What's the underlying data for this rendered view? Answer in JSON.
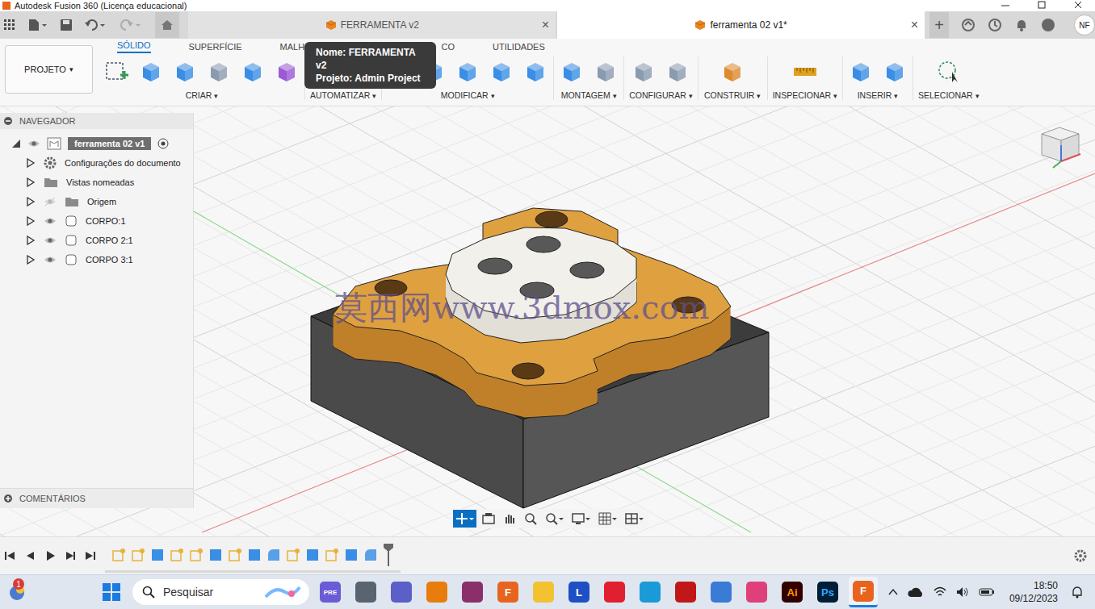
{
  "window": {
    "title": "Autodesk Fusion 360 (Licença educacional)"
  },
  "document_tabs": [
    {
      "label": "FERRAMENTA v2",
      "selected": false,
      "close": "×"
    },
    {
      "label": "ferramenta 02 v1*",
      "selected": true,
      "close": "×"
    }
  ],
  "new_tab": "+",
  "user": {
    "initials": "NF"
  },
  "tooltip": {
    "lines": [
      "Nome: FERRAMENTA v2",
      "Projeto: Admin Project"
    ]
  },
  "workspace_tabs": [
    {
      "label": "SÓLIDO",
      "selected": true
    },
    {
      "label": "SUPERFÍCIE",
      "selected": false
    },
    {
      "label": "MALHA",
      "selected": false
    },
    {
      "label": "CO",
      "selected": false
    },
    {
      "label": "UTILIDADES",
      "selected": false
    }
  ],
  "project_button": {
    "label": "PROJETO",
    "caret": "▾"
  },
  "tool_groups": [
    {
      "label": "CRIAR",
      "caret": "▾",
      "icons": [
        "sketch",
        "box",
        "sweep",
        "hole",
        "pattern",
        "form"
      ]
    },
    {
      "label": "AUTOMATIZAR",
      "caret": "▾",
      "icons": [
        "automate"
      ]
    },
    {
      "label": "MODIFICAR",
      "caret": "▾",
      "icons": [
        "press-pull",
        "fillet",
        "shell",
        "combine",
        "align"
      ]
    },
    {
      "label": "MONTAGEM",
      "caret": "▾",
      "icons": [
        "new-component",
        "joint"
      ]
    },
    {
      "label": "CONFIGURAR",
      "caret": "▾",
      "icons": [
        "parameters",
        "table"
      ]
    },
    {
      "label": "CONSTRUIR",
      "caret": "▾",
      "icons": [
        "plane"
      ]
    },
    {
      "label": "INSPECIONAR",
      "caret": "▾",
      "icons": [
        "measure"
      ]
    },
    {
      "label": "INSERIR",
      "caret": "▾",
      "icons": [
        "insert",
        "image"
      ]
    },
    {
      "label": "SELECIONAR",
      "caret": "▾",
      "icons": [
        "select"
      ]
    }
  ],
  "navigator": {
    "title": "NAVEGADOR",
    "root": {
      "label": "ferramenta 02 v1",
      "selected": true,
      "expanded": true,
      "visible": true
    },
    "items": [
      {
        "label": "Configurações do documento",
        "kind": "settings",
        "expanded": false
      },
      {
        "label": "Vistas nomeadas",
        "kind": "folder",
        "expanded": false
      },
      {
        "label": "Origem",
        "kind": "folder",
        "expanded": false,
        "visible": false
      },
      {
        "label": "CORPO:1",
        "kind": "body",
        "expanded": false,
        "visible": true
      },
      {
        "label": "CORPO 2:1",
        "kind": "body",
        "expanded": false,
        "visible": true
      },
      {
        "label": "CORPO 3:1",
        "kind": "body",
        "expanded": false,
        "visible": true
      }
    ],
    "comments": "COMENTÁRIOS"
  },
  "watermark": "莫西网www.3dmox.com",
  "timeline": {
    "features": [
      "sketch",
      "sketch",
      "extrude",
      "sketch",
      "sketch",
      "extrude",
      "sketch",
      "extrude",
      "fillet",
      "sketch",
      "extrude",
      "sketch",
      "extrude",
      "fillet"
    ]
  },
  "taskbar": {
    "notification_count": "1",
    "search_placeholder": "Pesquisar",
    "time": "18:50",
    "date": "09/12/2023",
    "apps": [
      {
        "name": "copilot",
        "glyph": "PRE",
        "color": "#6b5bd6",
        "glyph_color": "#ffffff",
        "active": false
      },
      {
        "name": "task-view",
        "glyph": "",
        "color": "#5a6470",
        "glyph_color": "#ffffff",
        "active": false
      },
      {
        "name": "chat",
        "glyph": "",
        "color": "#5b5fc7",
        "glyph_color": "#ffffff",
        "active": false
      },
      {
        "name": "blender",
        "glyph": "",
        "color": "#e87d0d",
        "glyph_color": "#ffffff",
        "active": false
      },
      {
        "name": "winrar",
        "glyph": "",
        "color": "#8b2f6b",
        "glyph_color": "#ffffff",
        "active": false
      },
      {
        "name": "fusion-360",
        "glyph": "F",
        "color": "#e8641e",
        "glyph_color": "#ffffff",
        "active": false
      },
      {
        "name": "file-explorer",
        "glyph": "",
        "color": "#f2c230",
        "glyph_color": "#ffffff",
        "active": false
      },
      {
        "name": "l-app",
        "glyph": "L",
        "color": "#1f4fc4",
        "glyph_color": "#ffffff",
        "active": false
      },
      {
        "name": "opera",
        "glyph": "",
        "color": "#e0202e",
        "glyph_color": "#ffffff",
        "active": false
      },
      {
        "name": "edge",
        "glyph": "",
        "color": "#1a9ad6",
        "glyph_color": "#ffffff",
        "active": false
      },
      {
        "name": "mcafee",
        "glyph": "",
        "color": "#c01818",
        "glyph_color": "#ffffff",
        "active": false
      },
      {
        "name": "store",
        "glyph": "",
        "color": "#3a7bd5",
        "glyph_color": "#ffffff",
        "active": false
      },
      {
        "name": "creative-cloud",
        "glyph": "",
        "color": "#e0407a",
        "glyph_color": "#ffffff",
        "active": false
      },
      {
        "name": "illustrator",
        "glyph": "Ai",
        "color": "#330000",
        "glyph_color": "#ff9a00",
        "active": false
      },
      {
        "name": "photoshop",
        "glyph": "Ps",
        "color": "#001e36",
        "glyph_color": "#31a8ff",
        "active": false
      },
      {
        "name": "fusion-360-active",
        "glyph": "F",
        "color": "#e8641e",
        "glyph_color": "#ffffff",
        "active": true
      }
    ]
  }
}
